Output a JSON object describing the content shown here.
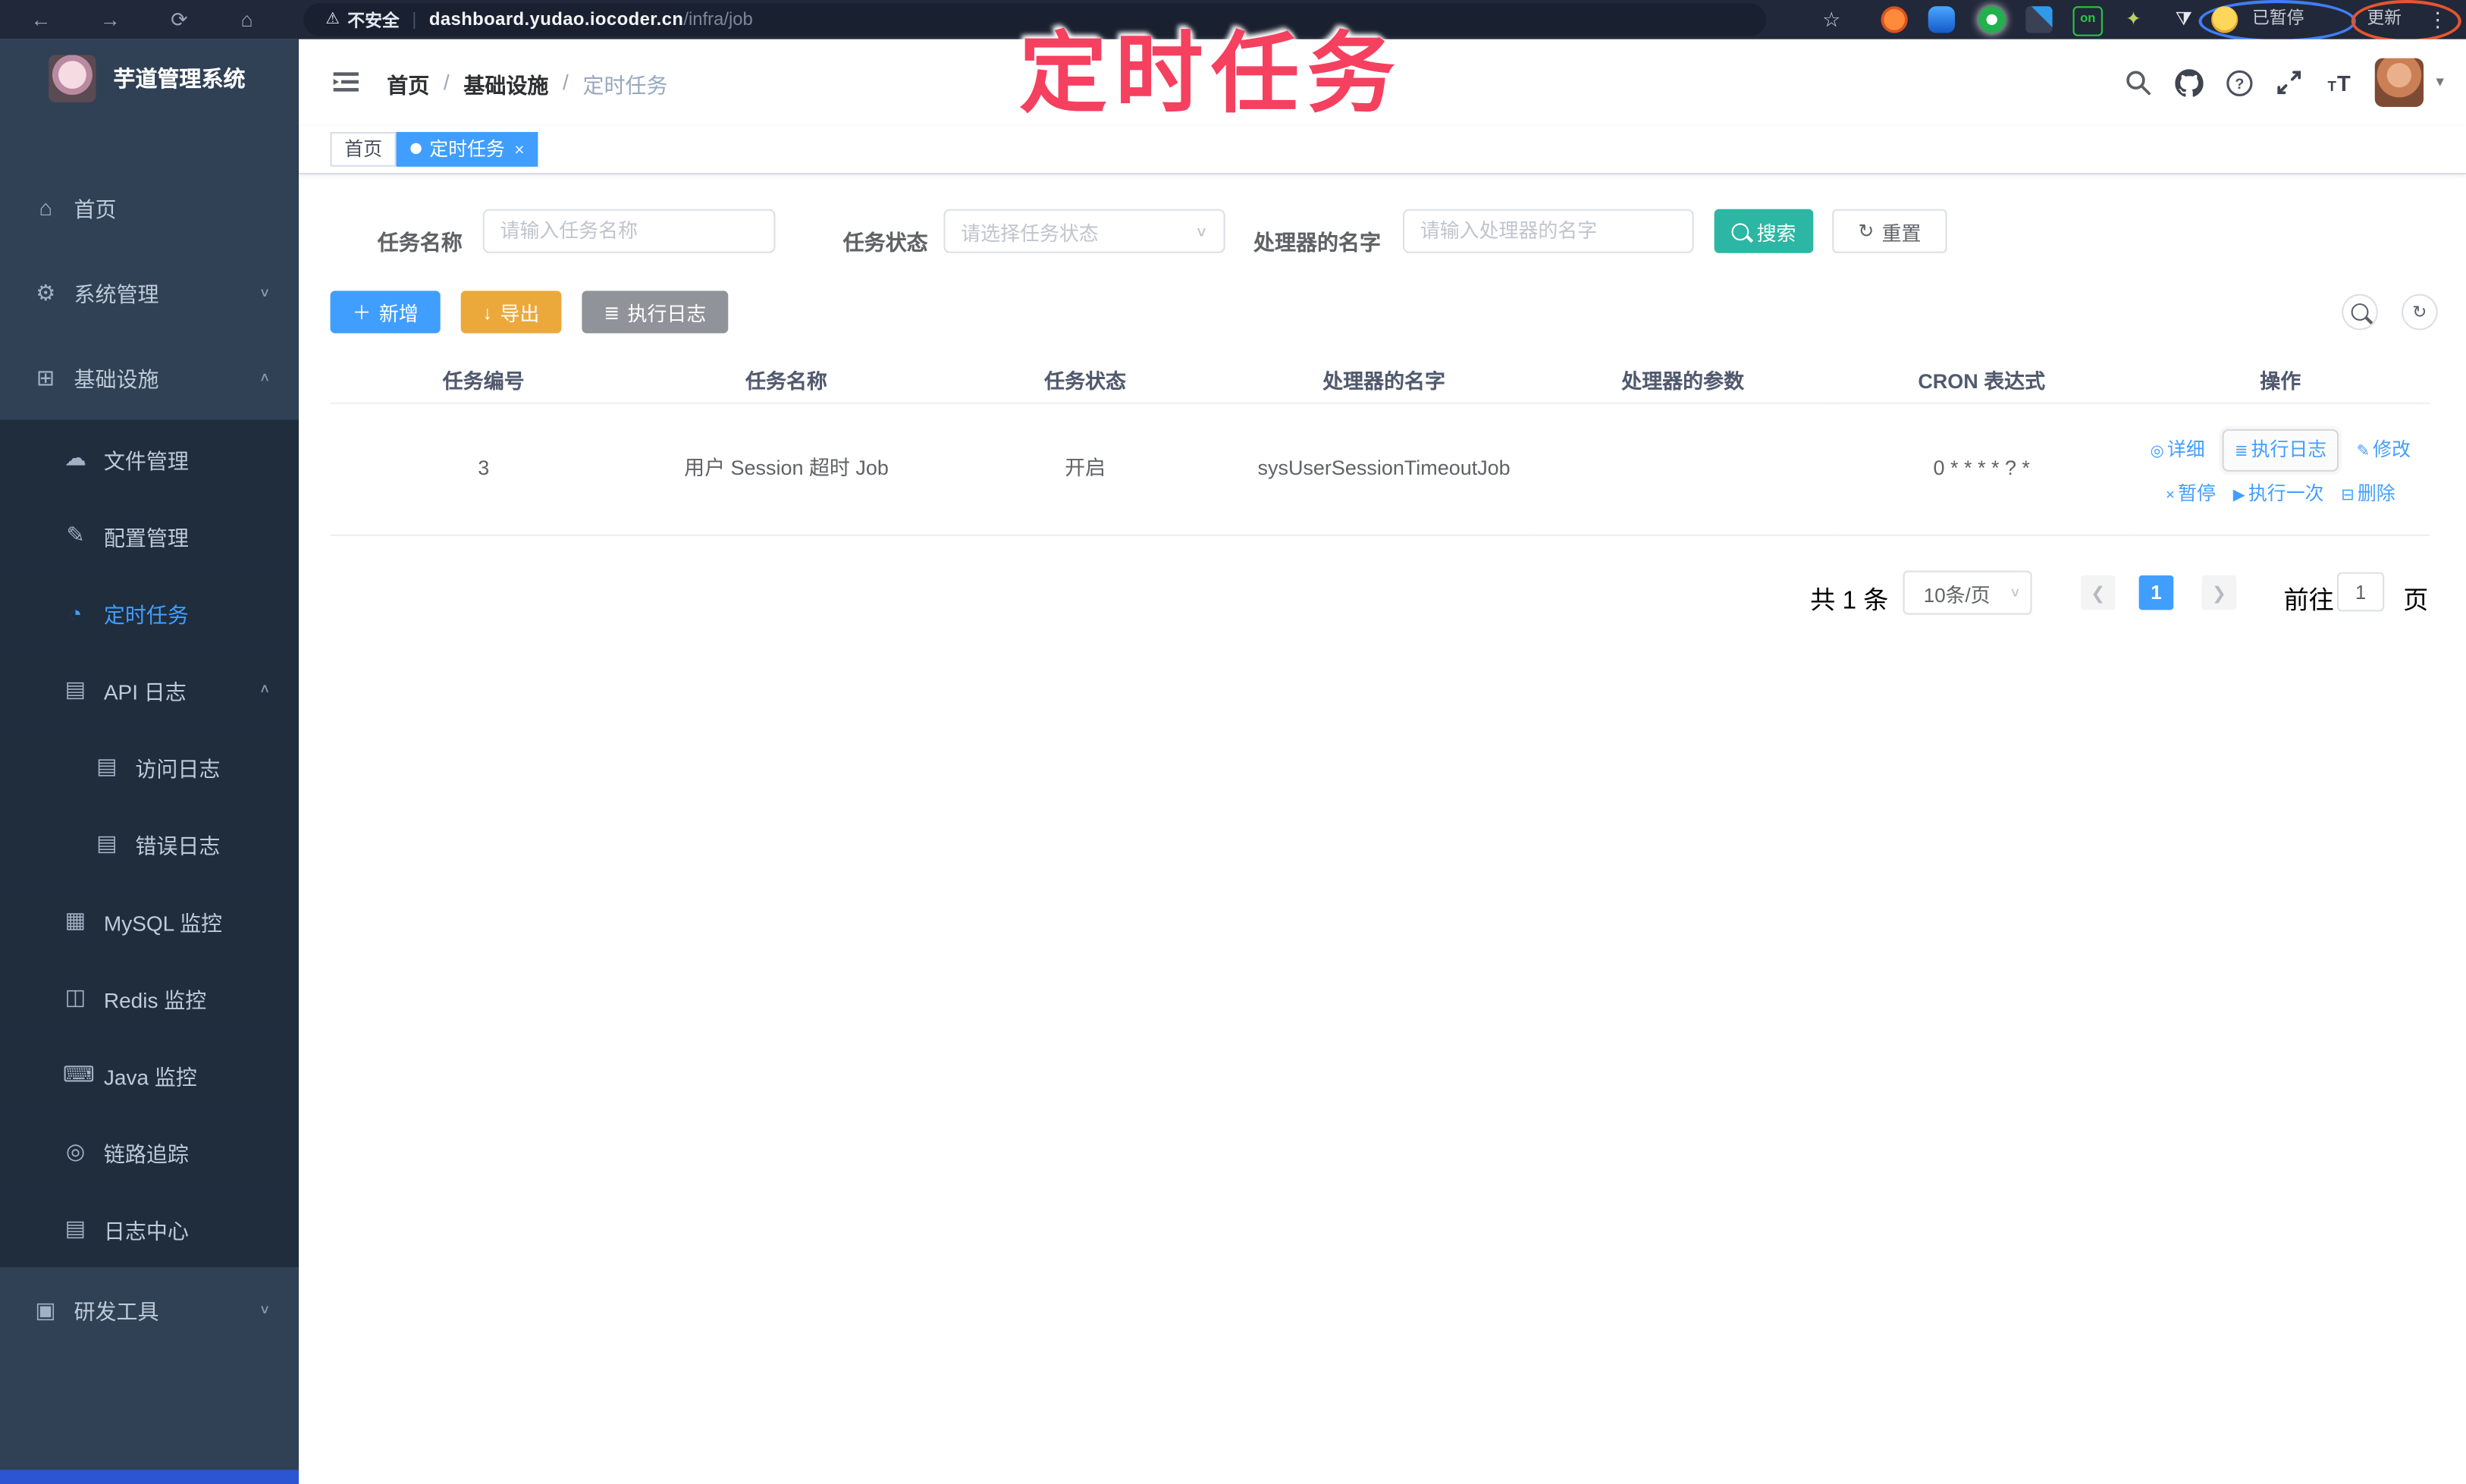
{
  "colors": {
    "accent": "#409eff",
    "sidebar_bg": "#304156",
    "submenu_bg": "#1f2d3d",
    "sidebar_text": "#bfcbd9",
    "browser_bar": "#212839",
    "url_capsule": "#19202f",
    "teal": "#2bb7a3",
    "warning": "#eba93c",
    "info": "#909399",
    "annotation": "#f5405f",
    "border": "#dcdfe6",
    "tab_border": "#d8dce5",
    "header_icon": "#5a5e66",
    "page_btn_bg": "#f4f4f5"
  },
  "annotation": {
    "title": "定时任务"
  },
  "browser": {
    "secure_label": "不安全",
    "sep": "|",
    "url_host": "dashboard.yudao.iocoder.cn",
    "url_path": "/infra/job",
    "ext_on_label": "on",
    "paused_label": "已暂停",
    "update_label": "更新"
  },
  "icons": {
    "back": "←",
    "forward": "→",
    "reload": "⟳",
    "home_nav": "⌂",
    "warning": "⚠",
    "star": "☆",
    "dots": "⋮",
    "home": "⌂",
    "gear": "⚙",
    "infra": "⊞",
    "cloud": "☁",
    "config": "✎",
    "timer": "◔",
    "api": "▤",
    "access": "▤",
    "error": "▤",
    "mysql": "▦",
    "redis": "◫",
    "java": "⌨",
    "trace": "◎",
    "logcenter": "▤",
    "tools": "▣",
    "chev_down": "∨",
    "chev_up": "∧",
    "caret_down": "▾",
    "plus": "＋",
    "download": "↓",
    "list": "≣",
    "refresh": "↻",
    "detail": "◎",
    "exec": "≣",
    "edit": "✎",
    "pause": "×",
    "run": "▶",
    "del": "⊟",
    "close": "×",
    "prev": "❮",
    "next": "❯"
  },
  "sidebar": {
    "logo_title": "芋道管理系统",
    "items": [
      {
        "label": "首页"
      },
      {
        "label": "系统管理"
      },
      {
        "label": "基础设施"
      },
      {
        "label": "文件管理"
      },
      {
        "label": "配置管理"
      },
      {
        "label": "定时任务"
      },
      {
        "label": "API 日志"
      },
      {
        "label": "访问日志"
      },
      {
        "label": "错误日志"
      },
      {
        "label": "MySQL 监控"
      },
      {
        "label": "Redis 监控"
      },
      {
        "label": "Java 监控"
      },
      {
        "label": "链路追踪"
      },
      {
        "label": "日志中心"
      },
      {
        "label": "研发工具"
      }
    ]
  },
  "header": {
    "breadcrumb": [
      "首页",
      "基础设施",
      "定时任务"
    ],
    "sep": "/"
  },
  "tabs": [
    {
      "label": "首页"
    },
    {
      "label": "定时任务"
    }
  ],
  "filters": {
    "name_label": "任务名称",
    "name_placeholder": "请输入任务名称",
    "status_label": "任务状态",
    "status_placeholder": "请选择任务状态",
    "handler_label": "处理器的名字",
    "handler_placeholder": "请输入处理器的名字",
    "search_label": "搜索",
    "reset_label": "重置"
  },
  "toolbar": {
    "add_label": "新增",
    "export_label": "导出",
    "exec_log_label": "执行日志"
  },
  "table": {
    "headers": [
      "任务编号",
      "任务名称",
      "任务状态",
      "处理器的名字",
      "处理器的参数",
      "CRON 表达式",
      "操作"
    ],
    "row": {
      "id": "3",
      "name": "用户 Session 超时 Job",
      "status": "开启",
      "handler": "sysUserSessionTimeoutJob",
      "param": "",
      "cron": "0 * * * * ? *",
      "actions": [
        "详细",
        "执行日志",
        "修改",
        "暂停",
        "执行一次",
        "删除"
      ]
    }
  },
  "pagination": {
    "total": "共 1 条",
    "page_size": "10条/页",
    "page": "1",
    "goto_label": "前往",
    "goto_value": "1",
    "page_unit": "页"
  }
}
